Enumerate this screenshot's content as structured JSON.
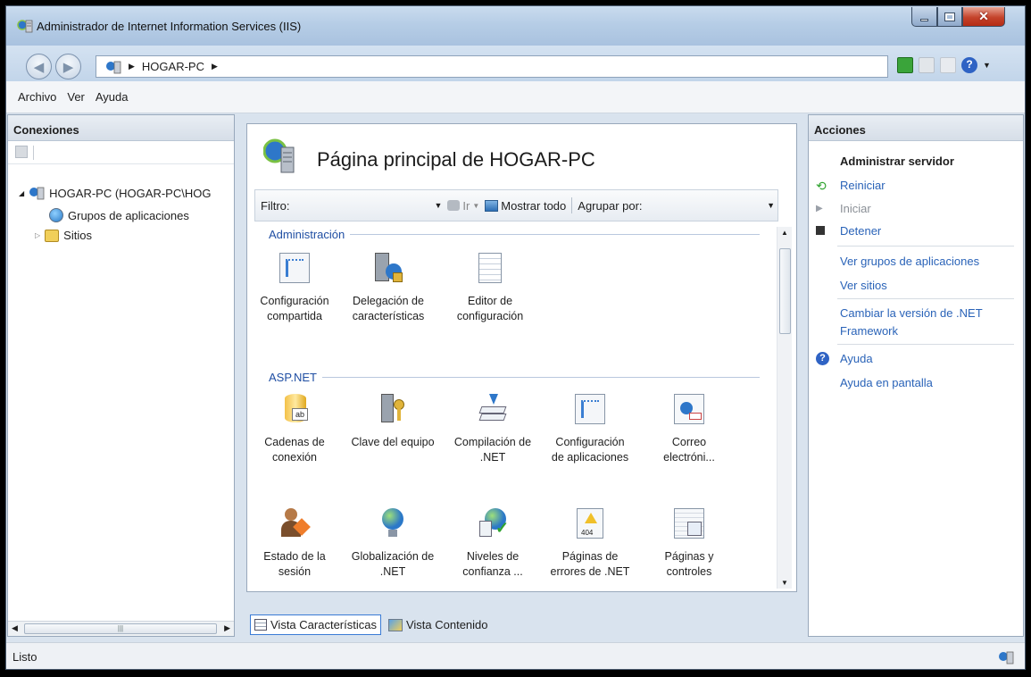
{
  "window": {
    "title": "Administrador de Internet Information Services (IIS)"
  },
  "address": {
    "crumb": "HOGAR-PC"
  },
  "menu": [
    "Archivo",
    "Ver",
    "Ayuda"
  ],
  "connections": {
    "title": "Conexiones",
    "tree": [
      "HOGAR-PC (HOGAR-PC\\HOG",
      "Grupos de aplicaciones",
      "Sitios"
    ]
  },
  "main": {
    "title": "Página principal de HOGAR-PC",
    "filter_label": "Filtro:",
    "go_label": "Ir",
    "show_all_label": "Mostrar todo",
    "group_by_label": "Agrupar por:",
    "groups": [
      {
        "name": "Administración",
        "features": [
          {
            "l1": "Configuración",
            "l2": "compartida"
          },
          {
            "l1": "Delegación de",
            "l2": "características"
          },
          {
            "l1": "Editor de",
            "l2": "configuración"
          }
        ]
      },
      {
        "name": "ASP.NET",
        "features": [
          {
            "l1": "Cadenas de",
            "l2": "conexión"
          },
          {
            "l1": "Clave del equipo",
            "l2": ""
          },
          {
            "l1": "Compilación de",
            "l2": ".NET"
          },
          {
            "l1": "Configuración",
            "l2": "de aplicaciones"
          },
          {
            "l1": "Correo",
            "l2": "electróni..."
          },
          {
            "l1": "Estado de la",
            "l2": "sesión"
          },
          {
            "l1": "Globalización de",
            "l2": ".NET"
          },
          {
            "l1": "Niveles de",
            "l2": "confianza ..."
          },
          {
            "l1": "Páginas de",
            "l2": "errores de .NET"
          },
          {
            "l1": "Páginas y",
            "l2": "controles"
          }
        ]
      }
    ],
    "view_tabs": [
      "Vista Características",
      "Vista Contenido"
    ]
  },
  "actions": {
    "title": "Acciones",
    "section": "Administrar servidor",
    "items": [
      "Reiniciar",
      "Iniciar",
      "Detener",
      "Ver grupos de aplicaciones",
      "Ver sitios",
      "Cambiar la versión de .NET",
      "Framework",
      "Ayuda",
      "Ayuda en pantalla"
    ]
  },
  "status": {
    "text": "Listo"
  },
  "colors": {
    "link": "#2a63b8",
    "group_header": "#1f4ea3",
    "close_button": "#c4432b"
  }
}
